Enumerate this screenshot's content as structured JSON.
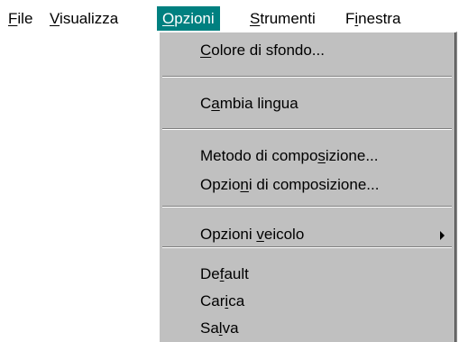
{
  "menubar": {
    "items": [
      {
        "pre": "",
        "key": "F",
        "post": "ile"
      },
      {
        "pre": "",
        "key": "V",
        "post": "isualizza"
      },
      {
        "pre": "",
        "key": "O",
        "post": "pzioni"
      },
      {
        "pre": "",
        "key": "S",
        "post": "trumenti"
      },
      {
        "pre": "F",
        "key": "i",
        "post": "nestra"
      }
    ],
    "active_index": 2
  },
  "dropdown": {
    "items": [
      {
        "pre": "",
        "key": "C",
        "post": "olore di sfondo..."
      },
      {
        "pre": "C",
        "key": "a",
        "post": "mbia lingua"
      },
      {
        "pre": "Metodo di compo",
        "key": "s",
        "post": "izione..."
      },
      {
        "pre": "Opzio",
        "key": "n",
        "post": "i di composizione..."
      },
      {
        "pre": "Opzioni ",
        "key": "v",
        "post": "eicolo",
        "submenu_icon": "triangle-right-icon"
      },
      {
        "pre": "De",
        "key": "f",
        "post": "ault"
      },
      {
        "pre": "Car",
        "key": "i",
        "post": "ca"
      },
      {
        "pre": "Sa",
        "key": "l",
        "post": "va"
      }
    ]
  },
  "colors": {
    "highlight": "#008080",
    "menu_face": "#c0c0c0"
  }
}
